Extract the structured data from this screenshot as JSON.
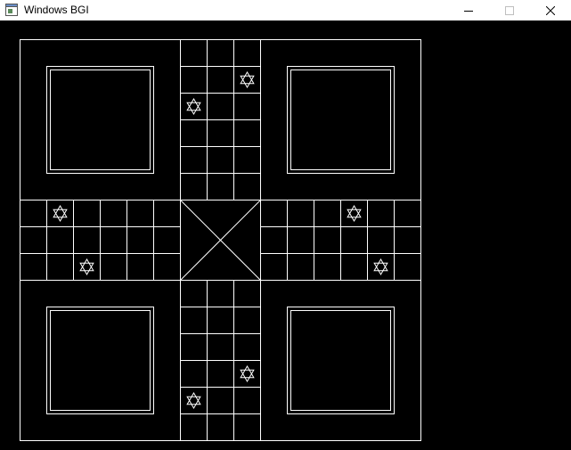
{
  "window": {
    "title": "Windows BGI",
    "icon": "bgi-app-icon",
    "controls": [
      "minimize-icon",
      "maximize-icon",
      "close-icon"
    ]
  },
  "colors": {
    "background": "#000000",
    "lines": "#ffffff",
    "titlebar": "#ffffff",
    "title_text": "#000000",
    "maximize_disabled": "#bfbfbf"
  },
  "board": {
    "type": "ludo",
    "home_bases": [
      "top-left",
      "top-right",
      "bottom-left",
      "bottom-right"
    ],
    "center": "crossed-square",
    "safe_spot_icon": "star-of-david-icon",
    "safe_spot_count": 8
  }
}
